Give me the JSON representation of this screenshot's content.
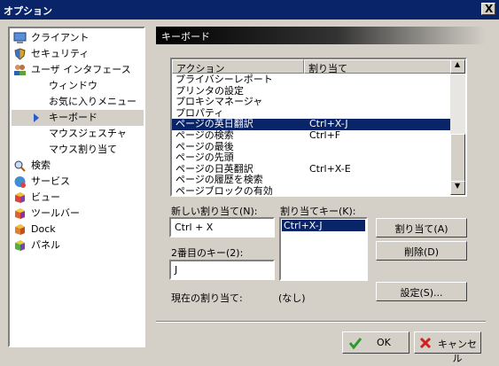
{
  "window": {
    "title": "オプション",
    "close": "X"
  },
  "nav": {
    "items": [
      {
        "label": "クライアント",
        "icon": "client-icon"
      },
      {
        "label": "セキュリティ",
        "icon": "shield-icon"
      },
      {
        "label": "ユーザ インタフェース",
        "icon": "users-icon"
      },
      {
        "label": "ウィンドウ",
        "icon": ""
      },
      {
        "label": "お気に入りメニュー",
        "icon": ""
      },
      {
        "label": "キーボード",
        "icon": "arrow-icon"
      },
      {
        "label": "マウスジェスチャ",
        "icon": ""
      },
      {
        "label": "マウス割り当て",
        "icon": ""
      },
      {
        "label": "検索",
        "icon": "magnifier-icon"
      },
      {
        "label": "サービス",
        "icon": "globe-icon"
      },
      {
        "label": "ビュー",
        "icon": "cube-icon"
      },
      {
        "label": "ツールバー",
        "icon": "cube-icon"
      },
      {
        "label": "Dock",
        "icon": "cube-icon"
      },
      {
        "label": "パネル",
        "icon": "cube-icon"
      }
    ]
  },
  "section": {
    "title": "キーボード"
  },
  "list": {
    "columns": [
      "アクション",
      "割り当て"
    ],
    "rows": [
      {
        "action": "プライバシーレポート",
        "key": ""
      },
      {
        "action": "プリンタの設定",
        "key": ""
      },
      {
        "action": "プロキシマネージャ",
        "key": ""
      },
      {
        "action": "プロパティ",
        "key": ""
      },
      {
        "action": "ページの英日翻訳",
        "key": "Ctrl+X-J"
      },
      {
        "action": "ページの検索",
        "key": "Ctrl+F"
      },
      {
        "action": "ページの最後",
        "key": ""
      },
      {
        "action": "ページの先頭",
        "key": ""
      },
      {
        "action": "ページの日英翻訳",
        "key": "Ctrl+X-E"
      },
      {
        "action": "ページの履歴を検索",
        "key": ""
      },
      {
        "action": "ページブロックの有効",
        "key": ""
      }
    ],
    "selected_index": 4
  },
  "form": {
    "new_assign_label": "新しい割り当て(N):",
    "new_assign_value": "Ctrl + X",
    "assign_key_label": "割り当てキー(K):",
    "assign_key_item": "Ctrl+X-J",
    "second_key_label": "2番目のキー(2):",
    "second_key_value": "J",
    "current_label": "現在の割り当て:",
    "current_value": "(なし)",
    "assign_button": "割り当て(A)",
    "delete_button": "削除(D)",
    "settings_button": "設定(S)..."
  },
  "footer": {
    "ok": "OK",
    "cancel": "キャンセル"
  },
  "colors": {
    "selection": "#0a246a",
    "title_bar": "#0a246a",
    "face": "#d4d0c8"
  }
}
